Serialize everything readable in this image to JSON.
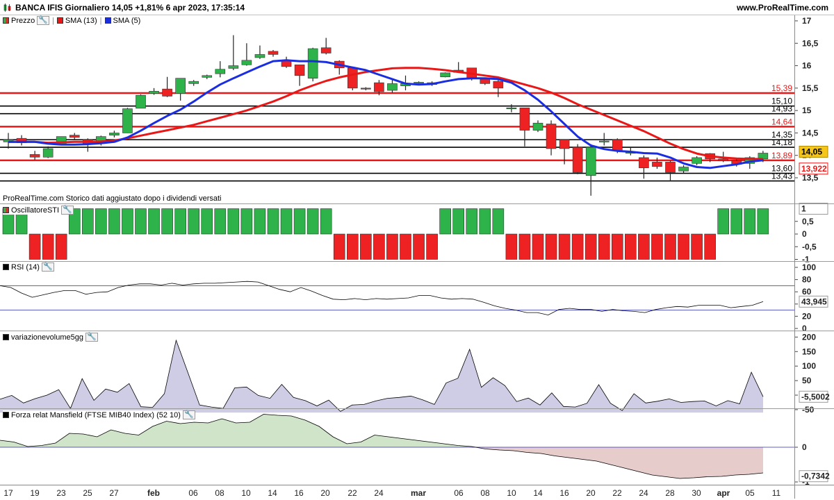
{
  "header": {
    "title": "BANCA IFIS Giornaliero 14,05 +1,81% 6 apr 2023, 17:35:14",
    "site": "www.ProRealTime.com"
  },
  "colors": {
    "green": "#2db34a",
    "red": "#ee2222",
    "sma13": "#e81818",
    "sma5": "#1a2ee0",
    "price_badge": "#f5c518"
  },
  "main_pane": {
    "labels": {
      "price": "Prezzo",
      "sma13": "SMA (13)",
      "sma5": "SMA (5)"
    },
    "footer_text": "ProRealTime.com  Storico dati aggiustato dopo i dividendi versati",
    "current_price": "14,05",
    "sma13_value": "13,922",
    "levels": [
      {
        "label": "15,39",
        "value": 15.39,
        "color": "red"
      },
      {
        "label": "15,10",
        "value": 15.1,
        "color": "black"
      },
      {
        "label": "14,93",
        "value": 14.93,
        "color": "black"
      },
      {
        "label": "14,64",
        "value": 14.64,
        "color": "red"
      },
      {
        "label": "14,35",
        "value": 14.35,
        "color": "black"
      },
      {
        "label": "14,18",
        "value": 14.18,
        "color": "black"
      },
      {
        "label": "13,89",
        "value": 13.89,
        "color": "red"
      },
      {
        "label": "13,60",
        "value": 13.6,
        "color": "black"
      },
      {
        "label": "13,43",
        "value": 13.43,
        "color": "black"
      }
    ],
    "y_ticks": [
      "17",
      "16,5",
      "16",
      "15,5",
      "15",
      "14,5",
      "14",
      "13,5"
    ]
  },
  "oscillator_pane": {
    "label": "OscillatoreSTI",
    "value": "1",
    "y_ticks": [
      "0,5",
      "0",
      "-0,5",
      "-1"
    ]
  },
  "rsi_pane": {
    "label": "RSI (14)",
    "value": "43,945",
    "y_ticks": [
      "100",
      "80",
      "60",
      "40",
      "20",
      "0"
    ]
  },
  "volume_pane": {
    "label": "variazionevolume5gg",
    "value": "-5,5002",
    "y_ticks": [
      "200",
      "150",
      "100",
      "50",
      "0",
      "-50"
    ]
  },
  "mansfield_pane": {
    "label": "Forza relat Mansfield (FTSE MIB40 Index) (52 10)",
    "value": "-0,7342",
    "y_ticks": [
      "0",
      "-1"
    ]
  },
  "x_axis": {
    "labels": [
      "17",
      "19",
      "23",
      "25",
      "27",
      "feb",
      "06",
      "08",
      "10",
      "14",
      "16",
      "20",
      "22",
      "24",
      "mar",
      "06",
      "08",
      "10",
      "14",
      "16",
      "20",
      "22",
      "24",
      "28",
      "30",
      "apr",
      "05",
      "11"
    ]
  },
  "chart_data": {
    "type": "candlestick",
    "candles": [
      {
        "o": 14.3,
        "h": 14.5,
        "l": 14.15,
        "c": 14.35
      },
      {
        "o": 14.38,
        "h": 14.45,
        "l": 14.22,
        "c": 14.28
      },
      {
        "o": 14.02,
        "h": 14.1,
        "l": 13.9,
        "c": 13.96
      },
      {
        "o": 13.96,
        "h": 14.2,
        "l": 13.94,
        "c": 14.15
      },
      {
        "o": 14.25,
        "h": 14.42,
        "l": 14.22,
        "c": 14.42
      },
      {
        "o": 14.45,
        "h": 14.5,
        "l": 14.35,
        "c": 14.4
      },
      {
        "o": 14.35,
        "h": 14.38,
        "l": 14.08,
        "c": 14.25
      },
      {
        "o": 14.28,
        "h": 14.44,
        "l": 14.22,
        "c": 14.42
      },
      {
        "o": 14.45,
        "h": 14.55,
        "l": 14.4,
        "c": 14.5
      },
      {
        "o": 14.5,
        "h": 15.06,
        "l": 14.5,
        "c": 15.04
      },
      {
        "o": 15.05,
        "h": 15.36,
        "l": 15.05,
        "c": 15.34
      },
      {
        "o": 15.38,
        "h": 15.5,
        "l": 15.35,
        "c": 15.43
      },
      {
        "o": 15.48,
        "h": 15.75,
        "l": 15.3,
        "c": 15.32
      },
      {
        "o": 15.38,
        "h": 15.72,
        "l": 15.22,
        "c": 15.72
      },
      {
        "o": 15.6,
        "h": 15.68,
        "l": 15.55,
        "c": 15.65
      },
      {
        "o": 15.74,
        "h": 15.8,
        "l": 15.7,
        "c": 15.78
      },
      {
        "o": 15.82,
        "h": 16.1,
        "l": 15.74,
        "c": 15.92
      },
      {
        "o": 15.94,
        "h": 16.68,
        "l": 15.9,
        "c": 16.0
      },
      {
        "o": 16.02,
        "h": 16.5,
        "l": 16.0,
        "c": 16.12
      },
      {
        "o": 16.18,
        "h": 16.45,
        "l": 16.15,
        "c": 16.25
      },
      {
        "o": 16.32,
        "h": 16.35,
        "l": 16.2,
        "c": 16.25
      },
      {
        "o": 16.12,
        "h": 16.2,
        "l": 15.95,
        "c": 15.98
      },
      {
        "o": 16.02,
        "h": 16.02,
        "l": 15.55,
        "c": 15.78
      },
      {
        "o": 15.72,
        "h": 16.4,
        "l": 15.65,
        "c": 16.38
      },
      {
        "o": 16.4,
        "h": 16.62,
        "l": 16.25,
        "c": 16.28
      },
      {
        "o": 16.1,
        "h": 16.12,
        "l": 15.8,
        "c": 15.95
      },
      {
        "o": 15.95,
        "h": 15.98,
        "l": 15.45,
        "c": 15.5
      },
      {
        "o": 15.5,
        "h": 15.52,
        "l": 15.45,
        "c": 15.48
      },
      {
        "o": 15.62,
        "h": 15.68,
        "l": 15.34,
        "c": 15.42
      },
      {
        "o": 15.45,
        "h": 15.72,
        "l": 15.4,
        "c": 15.6
      },
      {
        "o": 15.55,
        "h": 15.78,
        "l": 15.45,
        "c": 15.6
      },
      {
        "o": 15.62,
        "h": 15.65,
        "l": 15.58,
        "c": 15.63
      },
      {
        "o": 15.58,
        "h": 15.65,
        "l": 15.55,
        "c": 15.62
      },
      {
        "o": 15.75,
        "h": 15.85,
        "l": 15.74,
        "c": 15.84
      },
      {
        "o": 15.9,
        "h": 16.08,
        "l": 15.85,
        "c": 15.85
      },
      {
        "o": 15.95,
        "h": 15.95,
        "l": 15.67,
        "c": 15.72
      },
      {
        "o": 15.7,
        "h": 15.72,
        "l": 15.57,
        "c": 15.6
      },
      {
        "o": 15.65,
        "h": 15.7,
        "l": 15.3,
        "c": 15.5
      },
      {
        "o": 15.06,
        "h": 15.14,
        "l": 14.96,
        "c": 15.06
      },
      {
        "o": 15.06,
        "h": 15.06,
        "l": 14.2,
        "c": 14.56
      },
      {
        "o": 14.56,
        "h": 14.78,
        "l": 14.52,
        "c": 14.72
      },
      {
        "o": 14.7,
        "h": 14.78,
        "l": 14.0,
        "c": 14.15
      },
      {
        "o": 14.35,
        "h": 14.35,
        "l": 13.8,
        "c": 14.15
      },
      {
        "o": 14.18,
        "h": 14.25,
        "l": 13.58,
        "c": 13.62
      },
      {
        "o": 13.55,
        "h": 14.25,
        "l": 13.1,
        "c": 14.18
      },
      {
        "o": 14.3,
        "h": 14.5,
        "l": 14.22,
        "c": 14.32
      },
      {
        "o": 14.35,
        "h": 14.38,
        "l": 14.05,
        "c": 14.1
      },
      {
        "o": 14.05,
        "h": 14.18,
        "l": 14.0,
        "c": 14.07
      },
      {
        "o": 13.95,
        "h": 14.0,
        "l": 13.48,
        "c": 13.72
      },
      {
        "o": 13.85,
        "h": 13.95,
        "l": 13.7,
        "c": 13.75
      },
      {
        "o": 13.85,
        "h": 13.88,
        "l": 13.42,
        "c": 13.62
      },
      {
        "o": 13.65,
        "h": 13.78,
        "l": 13.6,
        "c": 13.74
      },
      {
        "o": 13.82,
        "h": 13.98,
        "l": 13.78,
        "c": 13.95
      },
      {
        "o": 14.04,
        "h": 14.05,
        "l": 13.85,
        "c": 13.92
      },
      {
        "o": 13.92,
        "h": 14.08,
        "l": 13.85,
        "c": 13.88
      },
      {
        "o": 13.88,
        "h": 13.92,
        "l": 13.75,
        "c": 13.8
      },
      {
        "o": 13.82,
        "h": 13.98,
        "l": 13.7,
        "c": 13.95
      },
      {
        "o": 13.92,
        "h": 14.1,
        "l": 13.85,
        "c": 14.05
      }
    ],
    "sma13": [
      14.3,
      14.3,
      14.3,
      14.28,
      14.29,
      14.3,
      14.3,
      14.31,
      14.33,
      14.38,
      14.44,
      14.5,
      14.56,
      14.62,
      14.68,
      14.76,
      14.84,
      14.92,
      15.0,
      15.1,
      15.2,
      15.32,
      15.45,
      15.56,
      15.66,
      15.74,
      15.8,
      15.86,
      15.9,
      15.94,
      15.95,
      15.95,
      15.93,
      15.9,
      15.86,
      15.82,
      15.78,
      15.74,
      15.66,
      15.58,
      15.5,
      15.4,
      15.28,
      15.14,
      15.02,
      14.9,
      14.78,
      14.66,
      14.54,
      14.4,
      14.26,
      14.14,
      14.04,
      13.98,
      13.95,
      13.93,
      13.92,
      13.92
    ],
    "sma5": [
      14.3,
      14.3,
      14.3,
      14.26,
      14.24,
      14.24,
      14.25,
      14.27,
      14.3,
      14.4,
      14.55,
      14.72,
      14.88,
      15.02,
      15.2,
      15.4,
      15.58,
      15.72,
      15.85,
      15.98,
      16.1,
      16.12,
      16.1,
      16.1,
      16.08,
      16.02,
      15.96,
      15.9,
      15.8,
      15.7,
      15.6,
      15.58,
      15.59,
      15.65,
      15.7,
      15.72,
      15.72,
      15.7,
      15.62,
      15.45,
      15.24,
      14.98,
      14.7,
      14.42,
      14.22,
      14.14,
      14.1,
      14.08,
      14.05,
      14.04,
      13.95,
      13.82,
      13.74,
      13.72,
      13.76,
      13.8,
      13.86,
      13.89
    ],
    "oscillator": [
      1,
      1,
      -1,
      -1,
      -1,
      1,
      1,
      1,
      1,
      1,
      1,
      1,
      1,
      1,
      1,
      1,
      1,
      1,
      1,
      1,
      1,
      1,
      1,
      1,
      1,
      -1,
      -1,
      -1,
      -1,
      -1,
      -1,
      -1,
      -1,
      1,
      1,
      1,
      1,
      1,
      -1,
      -1,
      -1,
      -1,
      -1,
      -1,
      -1,
      -1,
      -1,
      -1,
      -1,
      -1,
      -1,
      -1,
      -1,
      -1,
      1,
      1,
      1,
      1
    ],
    "rsi": [
      70,
      67,
      58,
      51,
      55,
      59,
      62,
      62,
      56,
      59,
      60,
      67,
      71,
      73,
      73,
      71,
      74,
      71,
      73,
      74,
      74,
      75,
      76,
      77,
      76,
      70,
      64,
      60,
      67,
      61,
      54,
      48,
      47,
      49,
      47,
      49,
      48,
      49,
      50,
      54,
      54,
      50,
      48,
      49,
      48,
      43,
      37,
      33,
      30,
      26,
      26,
      22,
      31,
      33,
      31,
      31,
      28,
      31,
      29,
      28,
      26,
      31,
      34,
      36,
      35,
      38,
      38,
      38,
      34,
      36,
      38,
      44
    ],
    "volume": [
      -14,
      -1,
      -27,
      -12,
      0,
      19,
      -46,
      57,
      -18,
      21,
      10,
      40,
      -40,
      -42,
      5,
      189,
      78,
      -34,
      -41,
      -46,
      25,
      28,
      -1,
      -11,
      37,
      -8,
      -19,
      -37,
      -17,
      -56,
      -34,
      -32,
      -20,
      -11,
      -8,
      -3,
      -16,
      -32,
      42,
      58,
      158,
      27,
      60,
      33,
      -22,
      -10,
      -34,
      8,
      -39,
      -41,
      -28,
      36,
      -28,
      -53,
      5,
      -27,
      -21,
      -13,
      -25,
      -22,
      -20,
      -37,
      -19,
      -30,
      79,
      -5.5
    ],
    "mansfield": [
      0.2,
      0.15,
      0.02,
      0.05,
      0.12,
      0.4,
      0.38,
      0.3,
      0.5,
      0.4,
      0.35,
      0.6,
      0.75,
      0.68,
      0.72,
      0.7,
      0.82,
      0.7,
      0.72,
      0.95,
      0.92,
      0.9,
      0.78,
      0.6,
      0.3,
      0.1,
      0.15,
      0.35,
      0.3,
      0.25,
      0.2,
      0.15,
      0.1,
      0.05,
      0.02,
      -0.05,
      -0.08,
      -0.1,
      -0.15,
      -0.18,
      -0.25,
      -0.3,
      -0.35,
      -0.4,
      -0.5,
      -0.6,
      -0.7,
      -0.8,
      -0.85,
      -0.9,
      -0.88,
      -0.85,
      -0.84,
      -0.8,
      -0.78,
      -0.74
    ]
  }
}
